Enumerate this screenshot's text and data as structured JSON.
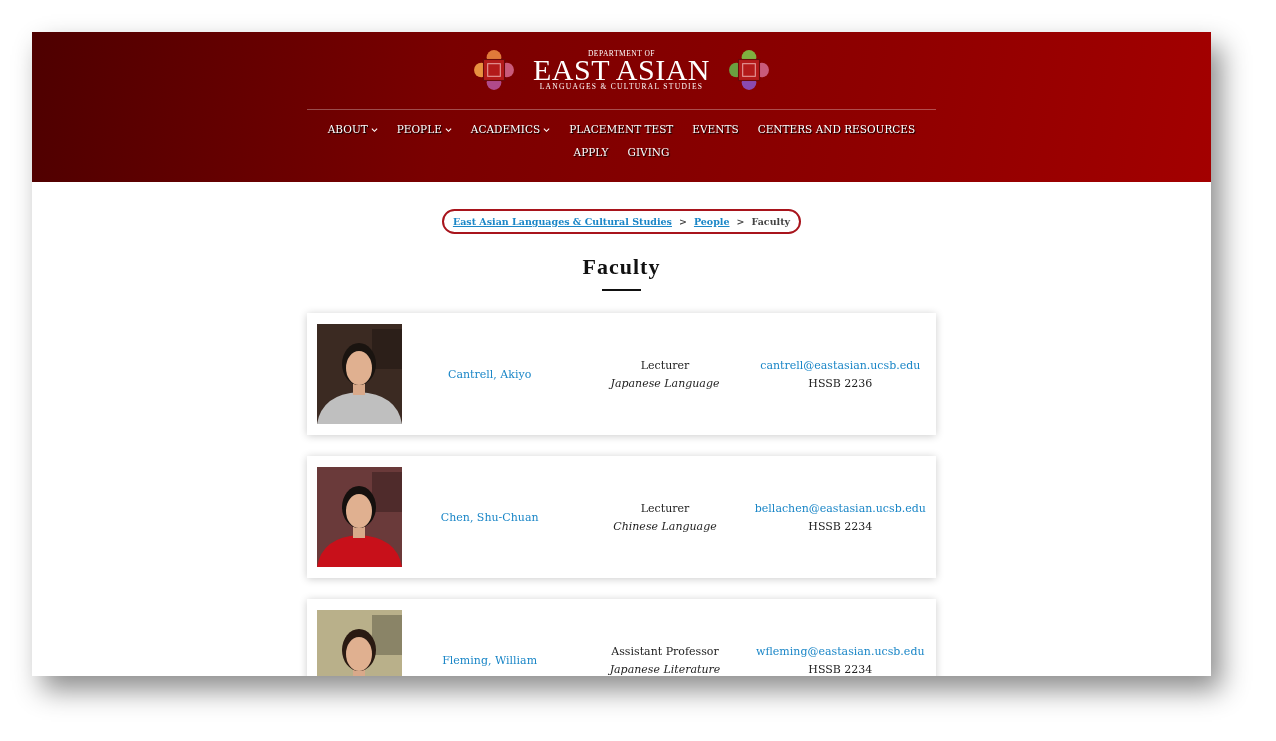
{
  "logo": {
    "line_1": "DEPARTMENT OF",
    "line_2": "EAST ASIAN",
    "line_3": "LANGUAGES & CULTURAL STUDIES"
  },
  "nav": [
    {
      "label": "ABOUT",
      "dropdown": true
    },
    {
      "label": "PEOPLE",
      "dropdown": true
    },
    {
      "label": "ACADEMICS",
      "dropdown": true
    },
    {
      "label": "PLACEMENT TEST",
      "dropdown": false
    },
    {
      "label": "EVENTS",
      "dropdown": false
    },
    {
      "label": "CENTERS AND RESOURCES",
      "dropdown": false
    },
    {
      "label": "APPLY",
      "dropdown": false
    },
    {
      "label": "GIVING",
      "dropdown": false
    }
  ],
  "breadcrumb": [
    {
      "label": "East Asian Languages & Cultural Studies",
      "link": true
    },
    {
      "separator": ">",
      "label": "People",
      "link": true
    },
    {
      "separator": ">",
      "label": "Faculty",
      "link": false
    }
  ],
  "page_title": "Faculty",
  "faculty": [
    {
      "name": "Cantrell, Akiyo",
      "position": "Lecturer",
      "field": "Japanese Language",
      "email": "cantrell@eastasian.ucsb.edu",
      "office": "HSSB 2236"
    },
    {
      "name": "Chen, Shu-Chuan",
      "position": "Lecturer",
      "field": "Chinese Language",
      "email": "bellachen@eastasian.ucsb.edu",
      "office": "HSSB 2234"
    },
    {
      "name": "Fleming, William",
      "position": "Assistant Professor",
      "field": "Japanese Literature",
      "email": "wfleming@eastasian.ucsb.edu",
      "office": "HSSB 2234"
    }
  ]
}
